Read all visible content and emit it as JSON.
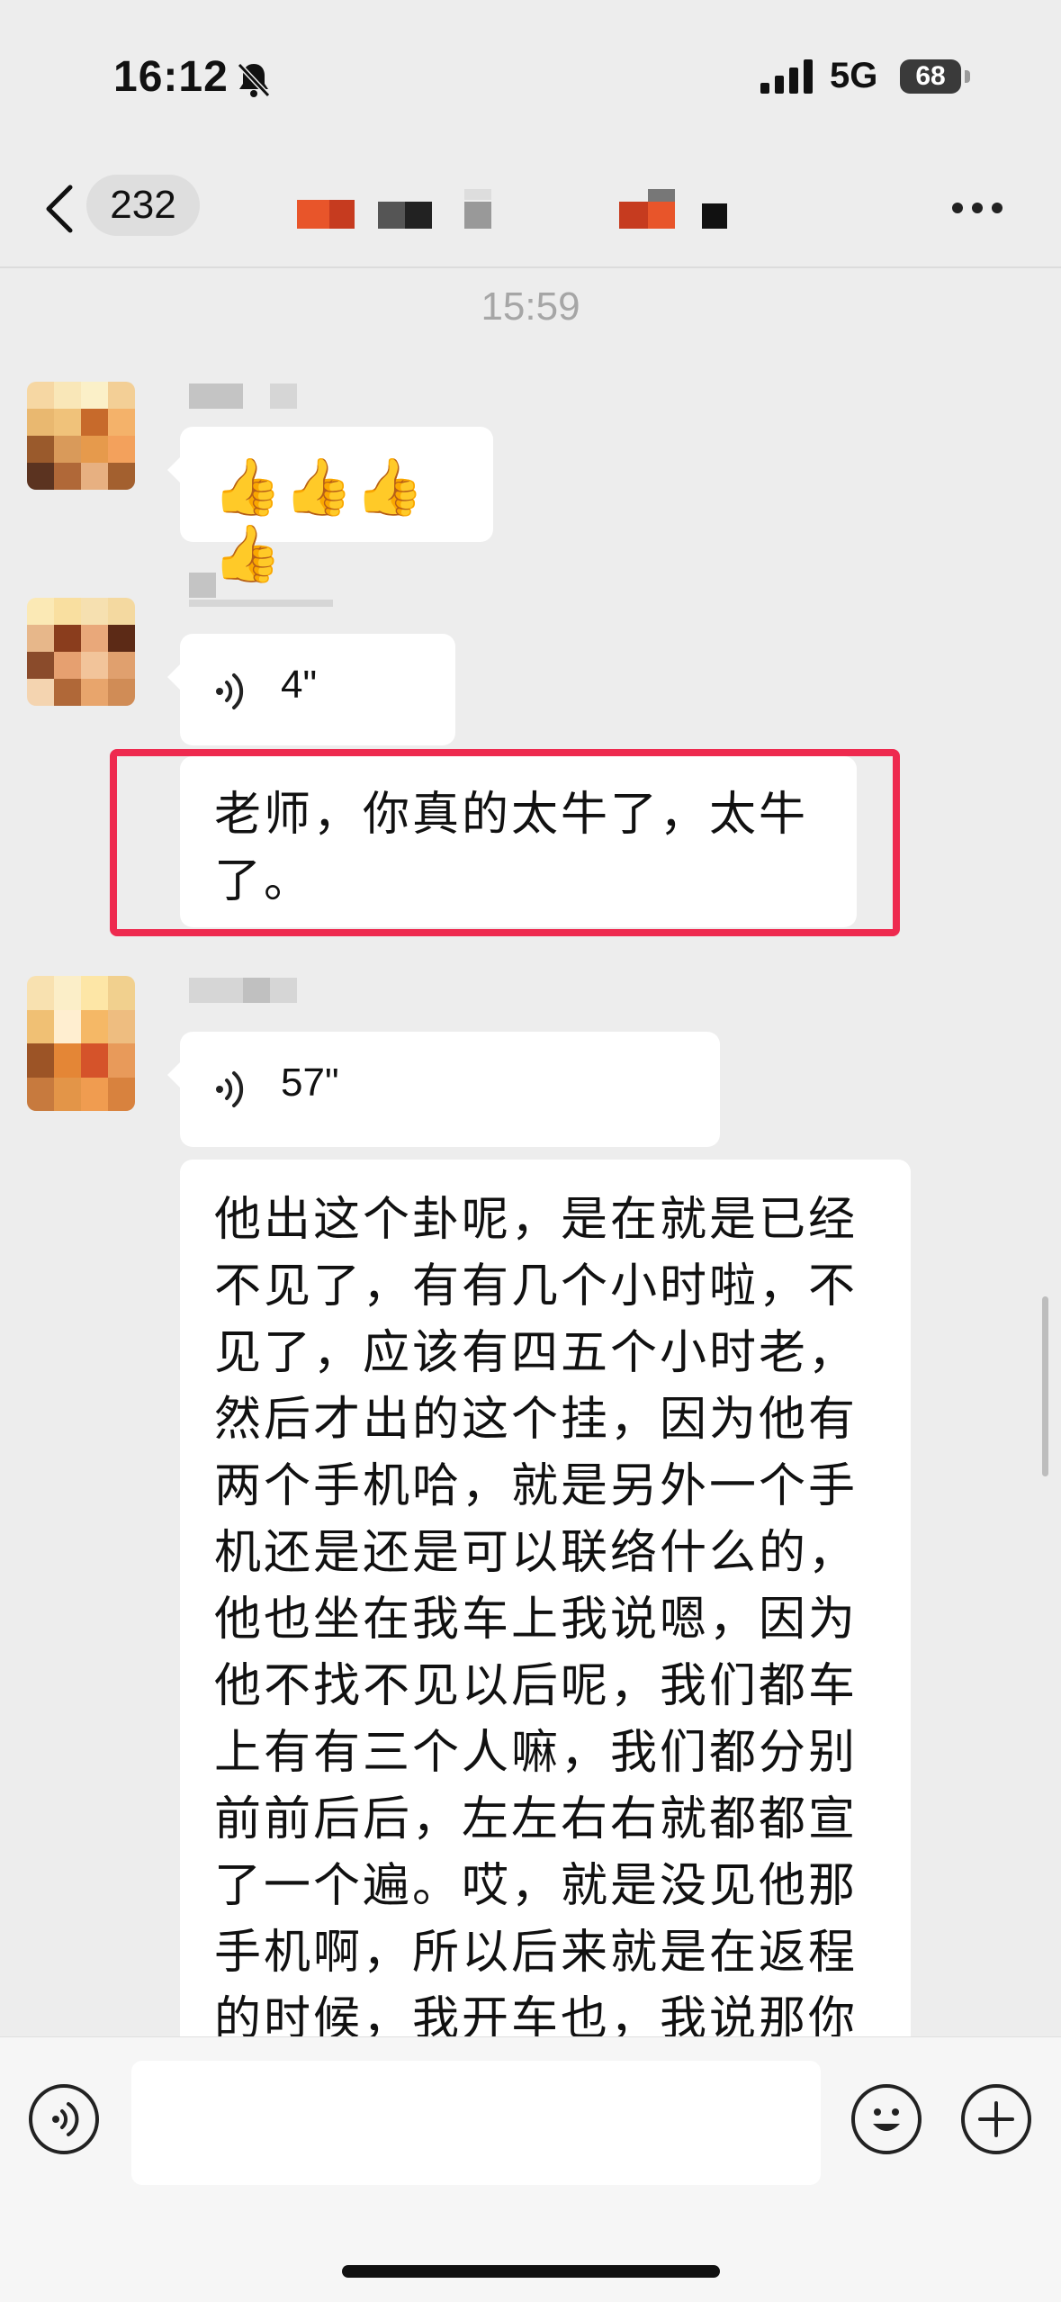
{
  "status_bar": {
    "time": "16:12",
    "network": "5G",
    "battery": "68",
    "icons": [
      "bell-muted-icon",
      "signal-icon",
      "battery-icon"
    ]
  },
  "nav": {
    "back_count": "232",
    "icons": [
      "chevron-left-icon",
      "more-icon"
    ]
  },
  "chat": {
    "timestamp": "15:59",
    "messages": [
      {
        "type": "emoji",
        "text": "👍👍👍👍"
      },
      {
        "type": "voice",
        "duration": "4\""
      },
      {
        "type": "text",
        "text": "老师，你真的太牛了，太牛\n了。"
      },
      {
        "type": "voice",
        "duration": "57\""
      },
      {
        "type": "text",
        "text": "他出这个卦呢，是在就是已经\n不见了，有有几个小时啦，不\n见了，应该有四五个小时老，\n然后才出的这个挂，因为他有\n两个手机哈，就是另外一个手\n机还是还是可以联络什么的，\n他也坐在我车上我说嗯，因为\n他不找不见以后呢，我们都车\n上有有三个人嘛，我们都分别\n前前后后，左左右右就都都宣\n了一个遍。哎，就是没见他那\n手机啊，所以后来就是在返程\n的时候，我开车也，我说那你"
      }
    ]
  },
  "input_bar": {
    "icons": [
      "voice-input-icon",
      "emoji-icon",
      "add-icon"
    ]
  },
  "colors": {
    "highlight": "#ee2a4f",
    "background": "#ededed",
    "bubble": "#ffffff"
  }
}
